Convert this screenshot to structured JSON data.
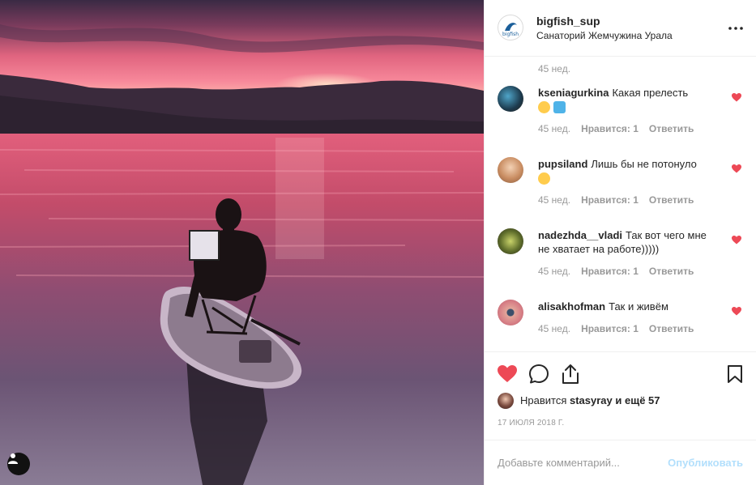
{
  "colors": {
    "heart_red": "#ed4956",
    "text": "#262626",
    "muted": "#999999",
    "publish": "#b2dffc",
    "border": "#efefef"
  },
  "post": {
    "username": "bigfish_sup",
    "location": "Санаторий Жемчужина Урала",
    "logo_text": "bigfish",
    "more_icon": "more-horizontal-icon",
    "photo_icon": "user-tag-icon"
  },
  "previous_comment_time": "45 нед.",
  "comments": [
    {
      "user": "kseniagurkina",
      "text": "Какая прелесть",
      "emoji": [
        "grinning-face-emoji",
        "person-bathing-emoji"
      ],
      "time": "45 нед.",
      "likes": "Нравится: 1",
      "reply": "Ответить",
      "icon": "heart-icon"
    },
    {
      "user": "pupsiland",
      "text": "Лишь бы не потонуло",
      "emoji": [
        "smiling-face-emoji"
      ],
      "time": "45 нед.",
      "likes": "Нравится: 1",
      "reply": "Ответить",
      "icon": "heart-icon"
    },
    {
      "user": "nadezhda__vladi",
      "text": "Так вот чего мне не хватает на работе)))))",
      "emoji": [],
      "time": "45 нед.",
      "likes": "Нравится: 1",
      "reply": "Ответить",
      "icon": "heart-icon"
    },
    {
      "user": "alisakhofman",
      "text": "Так и живём",
      "emoji": [],
      "time": "45 нед.",
      "likes": "Нравится: 1",
      "reply": "Ответить",
      "icon": "heart-icon"
    }
  ],
  "actions": {
    "icons": [
      "heart-icon",
      "comment-icon",
      "share-icon",
      "bookmark-icon"
    ],
    "likes_prefix": "Нравится",
    "likes_user": "stasyray",
    "likes_suffix": "и ещё 57",
    "date": "17 ИЮЛЯ 2018 Г."
  },
  "add_comment": {
    "placeholder": "Добавьте комментарий...",
    "publish": "Опубликовать"
  }
}
